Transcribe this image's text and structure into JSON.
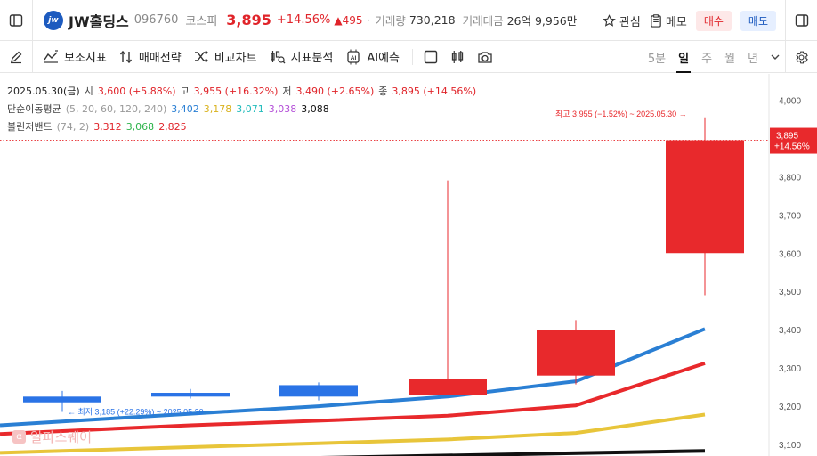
{
  "header": {
    "logo_text": "jw",
    "stock_name": "JW홀딩스",
    "stock_code": "096760",
    "market": "코스피",
    "price": "3,895",
    "change_pct": "+14.56%",
    "change_abs": "▲495",
    "volume_label": "거래량",
    "volume_value": "730,218",
    "amount_label": "거래대금",
    "amount_value": "26억 9,956만",
    "interest_label": "관심",
    "memo_label": "메모",
    "buy_label": "매수",
    "sell_label": "매도"
  },
  "toolbar": {
    "items": [
      "보조지표",
      "매매전략",
      "비교차트",
      "지표분석",
      "AI예측"
    ],
    "periods": [
      "5분",
      "일",
      "주",
      "월",
      "년"
    ],
    "active_period": "일"
  },
  "legend": {
    "ohlc": {
      "date": "2025.05.30(금)",
      "open_label": "시",
      "open": "3,600 (+5.88%)",
      "high_label": "고",
      "high": "3,955 (+16.32%)",
      "low_label": "저",
      "low": "3,490 (+2.65%)",
      "close_label": "종",
      "close": "3,895 (+14.56%)"
    },
    "sma": {
      "label": "단순이동평균",
      "params": "(5, 20, 60, 120, 240)",
      "values": [
        "3,402",
        "3,178",
        "3,071",
        "3,038",
        "3,088"
      ]
    },
    "bollinger": {
      "label": "볼린저밴드",
      "params": "(74, 2)",
      "values": [
        "3,312",
        "3,068",
        "2,825"
      ]
    }
  },
  "annotations": {
    "high_note": "최고 3,955 (−1.52%) ~ 2025.05.30 →",
    "low_note": "← 최저 3,185 (+22.29%) ~ 2025.05.30"
  },
  "price_tag": {
    "price": "3,895",
    "pct": "+14.56%"
  },
  "watermark": "알파스퀘어",
  "colors": {
    "up": "#e8292c",
    "down": "#2a73e6",
    "sma5": "#2a7fd4",
    "sma20": "#e8c53a",
    "sma60": "#27c4c4",
    "sma120": "#b44fd8",
    "sma240": "#111111",
    "bb_mid": "#2db34a",
    "bb_upper": "#e8292c",
    "bb_lower": "#e8292c"
  },
  "chart_data": {
    "type": "candlestick",
    "ylim": [
      3080,
      4040
    ],
    "y_ticks": [
      "4,000",
      "3,900",
      "3,800",
      "3,700",
      "3,600",
      "3,500",
      "3,400",
      "3,300",
      "3,200",
      "3,100"
    ],
    "candles": [
      {
        "open": 3225,
        "high": 3240,
        "low": 3185,
        "close": 3210
      },
      {
        "open": 3235,
        "high": 3245,
        "low": 3220,
        "close": 3225
      },
      {
        "open": 3255,
        "high": 3262,
        "low": 3215,
        "close": 3225
      },
      {
        "open": 3230,
        "high": 3790,
        "low": 3228,
        "close": 3270
      },
      {
        "open": 3280,
        "high": 3425,
        "low": 3257,
        "close": 3400
      },
      {
        "open": 3600,
        "high": 3955,
        "low": 3490,
        "close": 3895
      }
    ],
    "series": [
      {
        "name": "SMA5",
        "values": [
          3160,
          3180,
          3200,
          3225,
          3265,
          3402
        ]
      },
      {
        "name": "BB upper",
        "values": [
          3135,
          3150,
          3162,
          3175,
          3202,
          3312
        ]
      },
      {
        "name": "SMA20",
        "values": [
          3083,
          3093,
          3103,
          3113,
          3130,
          3178
        ]
      }
    ]
  }
}
